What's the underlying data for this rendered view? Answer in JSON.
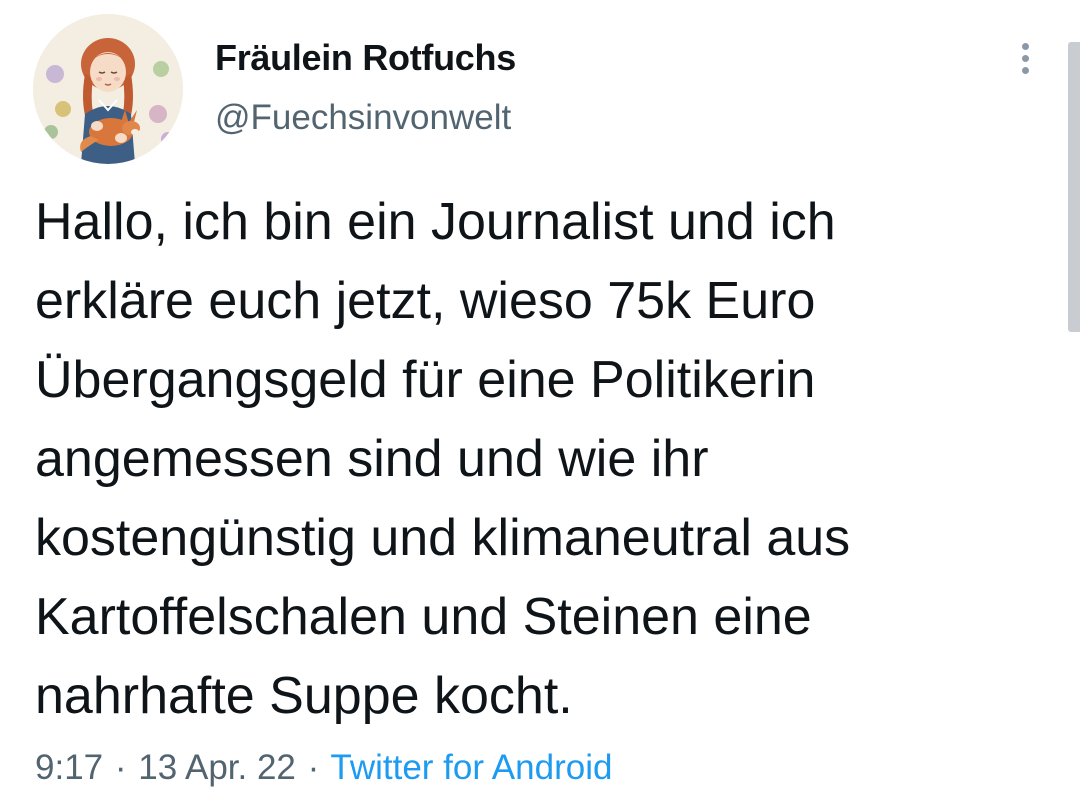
{
  "tweet": {
    "author": {
      "display_name": "Fräulein Rotfuchs",
      "handle": "@Fuechsinvonwelt",
      "avatar_icon": "avatar-illustration-girl-with-fox"
    },
    "menu_icon": "more-vertical-icon",
    "text_lines": [
      "Hallo, ich bin ein Journalist und ich",
      "erkläre euch jetzt, wieso 75k Euro",
      "Übergangsgeld für eine Politikerin",
      "angemessen sind und wie ihr",
      "kostengünstig und klimaneutral aus",
      "Kartoffelschalen und Steinen eine",
      "nahrhafte Suppe kocht."
    ],
    "time": "9:17",
    "date": "13 Apr. 22",
    "separator": "·",
    "source": "Twitter for Android"
  },
  "colors": {
    "text": "#0f1419",
    "secondary": "#536471",
    "link": "#1d9bf0",
    "background": "#ffffff"
  }
}
